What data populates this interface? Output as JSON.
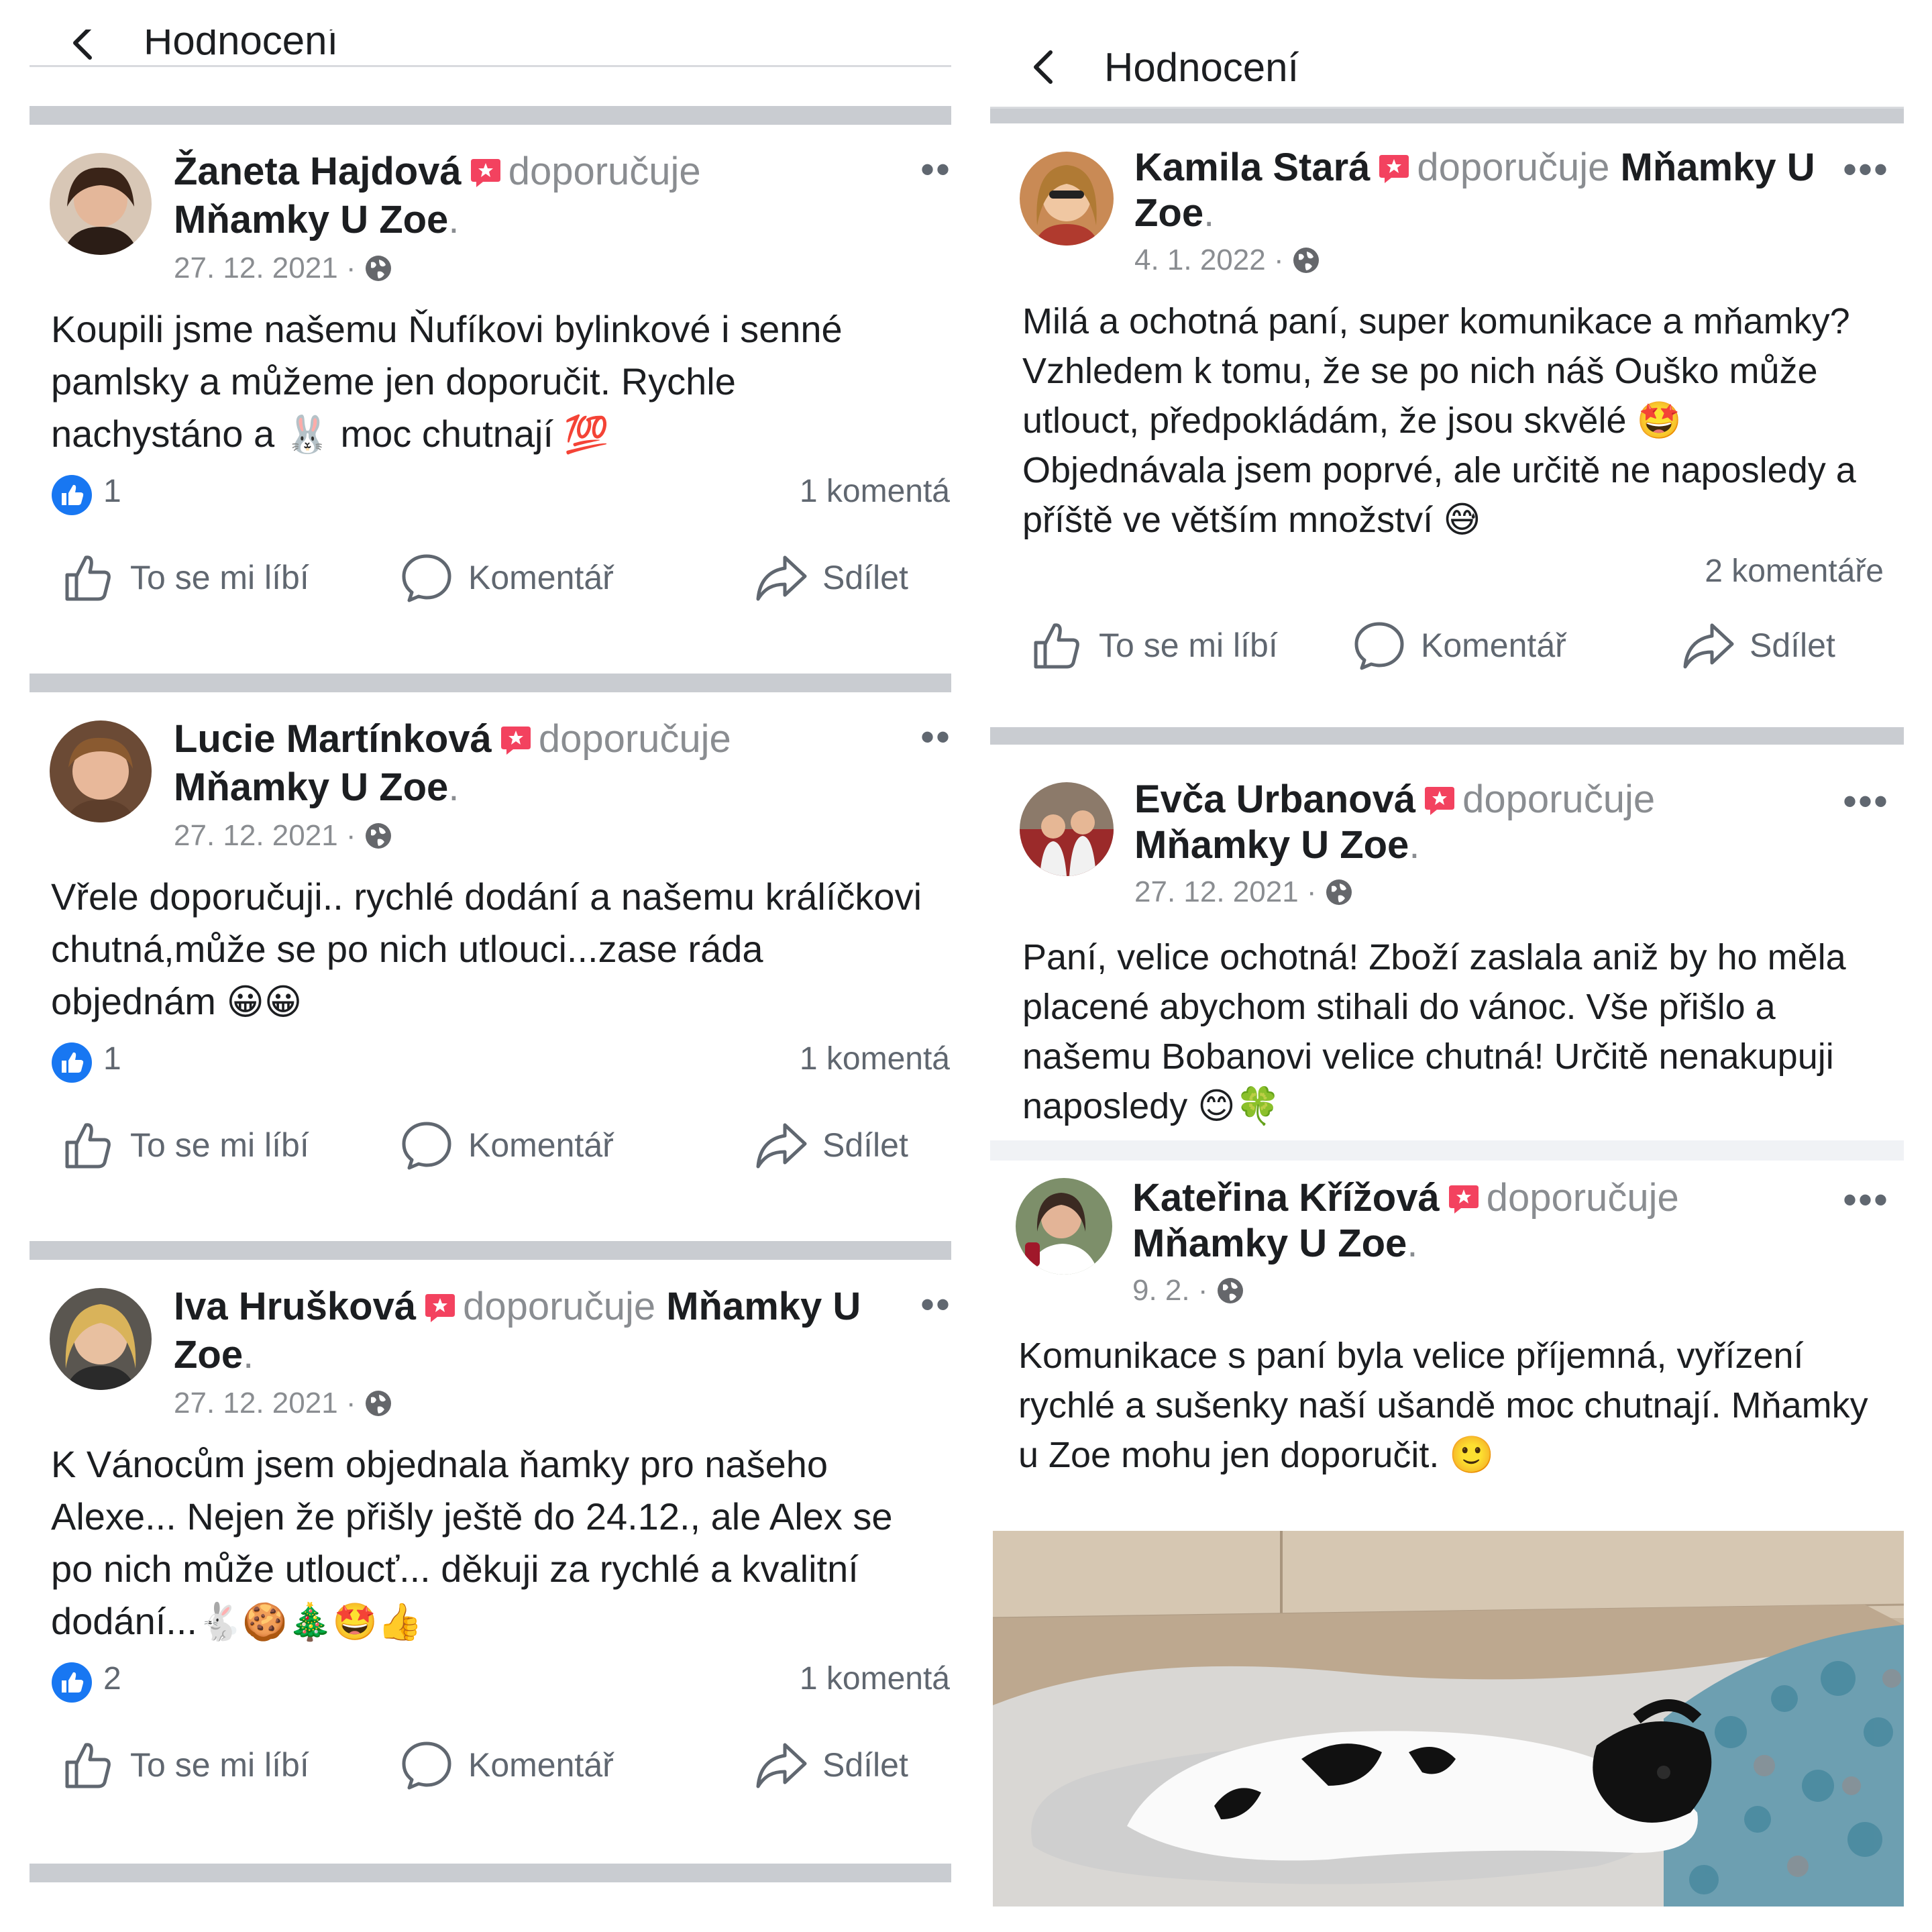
{
  "left": {
    "header_title": "Hodnocení",
    "posts": [
      {
        "author": "Žaneta Hajdová",
        "verb": "doporučuje",
        "page": "Mňamky U Zoe",
        "date": "27. 12. 2021 ·",
        "text_1": "Koupili jsme našemu Ňufíkovi bylinkové i senné pamlsky a můžeme jen doporučit. Rychle nachystáno a",
        "emoji_1": "🐰",
        "text_2": "moc chutnají",
        "emoji_2": "💯",
        "likes": "1",
        "comments": "1 komentá"
      },
      {
        "author": "Lucie Martínková",
        "verb": "doporučuje",
        "page": "Mňamky U Zoe",
        "date": "27. 12. 2021 ·",
        "text_1": "Vřele doporučuji.. rychlé dodání a našemu králíčkovi chutná,může se po nich utlouci...zase ráda objednám",
        "emoji_1": "😀😀",
        "likes": "1",
        "comments": "1 komentá"
      },
      {
        "author": "Iva Hrušková",
        "verb": "doporučuje",
        "page": "Mňamky U Zoe",
        "date": "27. 12. 2021 ·",
        "text_1": "K Vánocům jsem objednala ňamky pro našeho Alexe... Nejen že přišly ještě do 24.12., ale Alex se po nich může utloucť... děkuji za rychlé a kvalitní dodání...",
        "emoji_1": "🐇🍪🎄🤩👍",
        "likes": "2",
        "comments": "1 komentá"
      }
    ],
    "actions": {
      "like": "To se mi líbí",
      "comment": "Komentář",
      "share": "Sdílet"
    }
  },
  "right": {
    "header_title": "Hodnocení",
    "posts": [
      {
        "author": "Kamila Stará",
        "verb": "doporučuje",
        "page": "Mňamky U Zoe",
        "date": "4. 1. 2022 ·",
        "text_1": "Milá a ochotná paní, super komunikace a mňamky? Vzhledem k tomu, že se po nich náš Ouško může utlouct, předpokládám, že jsou skvělé",
        "emoji_1": "🤩",
        "text_2": "Objednávala jsem poprvé, ale určitě ne naposledy a příště ve větším množství",
        "emoji_2": "😅",
        "comments": "2 komentáře"
      },
      {
        "author": "Evča Urbanová",
        "verb": "doporučuje",
        "page": "Mňamky U Zoe",
        "date": "27. 12. 2021 ·",
        "text_1": "Paní, velice ochotná! Zboží zaslala aniž by ho měla placené abychom stihali do vánoc. Vše přišlo a našemu Bobanovi velice chutná! Určitě nenakupuji naposledy",
        "emoji_1": "😊🍀"
      },
      {
        "author": "Kateřina Křížová",
        "verb": "doporučuje",
        "page": "Mňamky U Zoe",
        "date": "9. 2. ·",
        "text_1": "Komunikace s paní byla velice příjemná, vyřízení rychlé a sušenky naší ušandě moc chutnají. Mňamky u Zoe mohu jen doporučit.",
        "emoji_1": "🙂"
      }
    ],
    "actions": {
      "like": "To se mi líbí",
      "comment": "Komentář",
      "share": "Sdílet"
    }
  },
  "icons": [
    "back-chevron-icon",
    "recommend-badge-icon",
    "globe-icon",
    "more-dots-icon",
    "like-reaction-icon",
    "thumbs-up-icon",
    "comment-bubble-icon",
    "share-arrow-icon"
  ],
  "colors": {
    "accent": "#1877f2",
    "recommend_badge": "#f3425f",
    "secondary_text": "#8a8d91",
    "separator": "#c9ccd1"
  }
}
